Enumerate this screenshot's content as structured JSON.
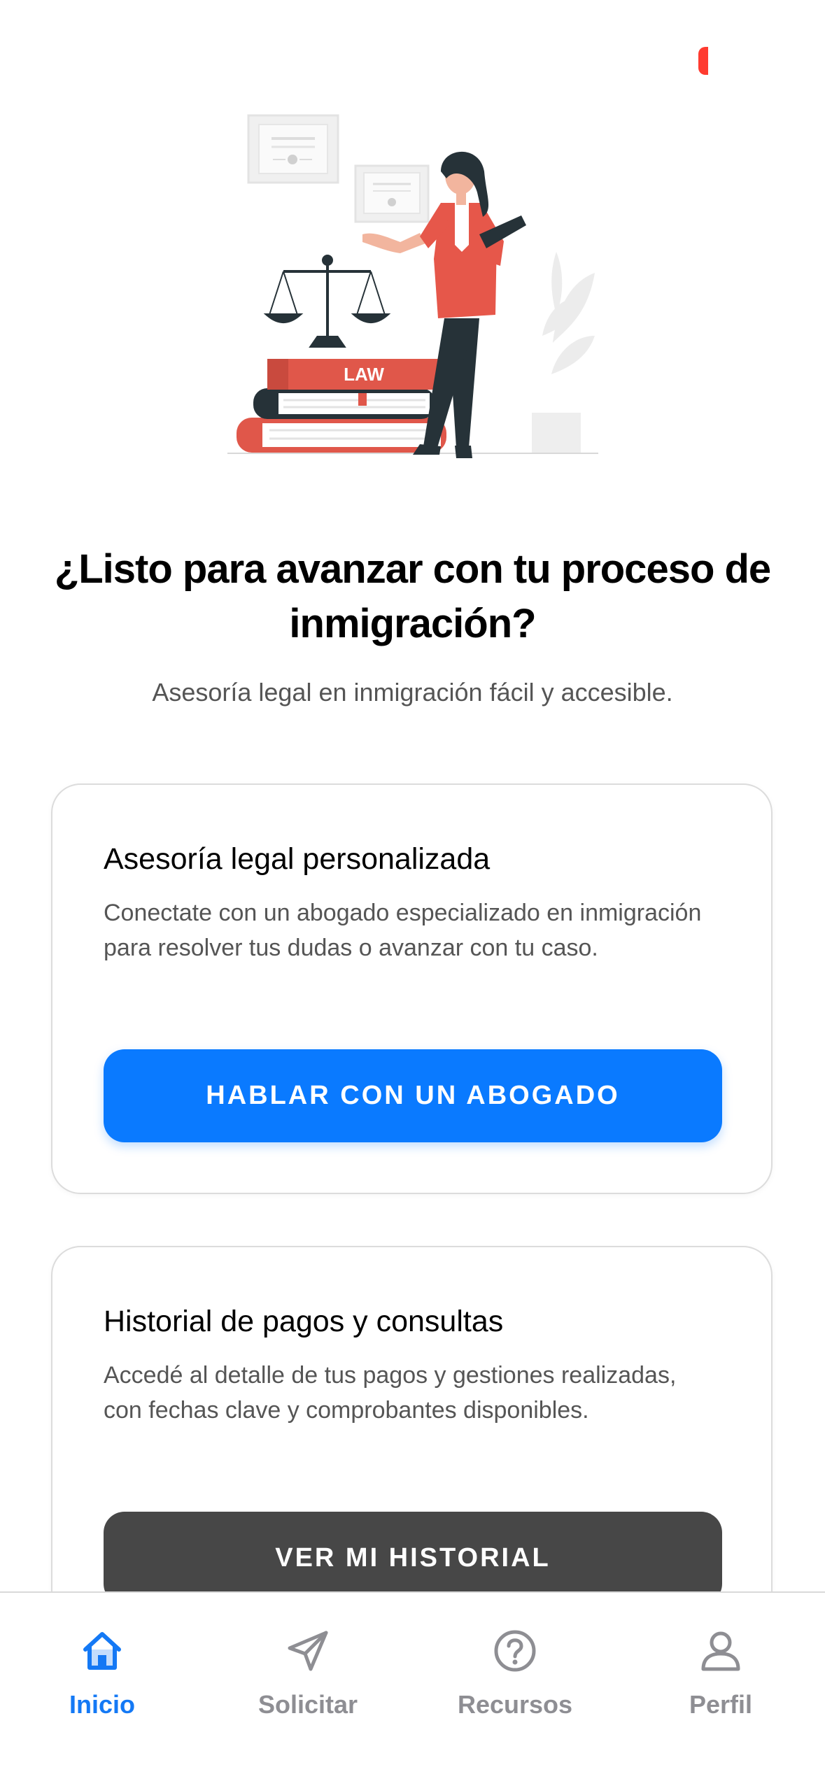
{
  "colors": {
    "accent": "#0a7aff",
    "dark_button": "#474747",
    "notification": "#ff3b30",
    "inactive_tab": "#8e8e93",
    "illustration_red": "#e6574a",
    "illustration_navy": "#263238"
  },
  "hero": {
    "illustration": "lawyer-woman-with-scales-and-law-books",
    "book_label": "LAW"
  },
  "header": {
    "title": "¿Listo para avanzar con tu proceso de inmigración?",
    "subtitle": "Asesoría legal en inmigración fácil y accesible."
  },
  "cards": [
    {
      "title": "Asesoría legal personalizada",
      "description": "Conectate con un abogado especializado en inmigración para resolver tus dudas o avanzar con tu caso.",
      "button_label": "HABLAR CON UN ABOGADO"
    },
    {
      "title": "Historial de pagos y consultas",
      "description": "Accedé al detalle de tus pagos y gestiones realizadas, con fechas clave y comprobantes disponibles.",
      "button_label": "VER MI HISTORIAL"
    }
  ],
  "tabbar": {
    "items": [
      {
        "label": "Inicio",
        "icon": "home-icon",
        "active": true
      },
      {
        "label": "Solicitar",
        "icon": "send-icon",
        "active": false
      },
      {
        "label": "Recursos",
        "icon": "help-circle-icon",
        "active": false
      },
      {
        "label": "Perfil",
        "icon": "user-icon",
        "active": false
      }
    ]
  }
}
